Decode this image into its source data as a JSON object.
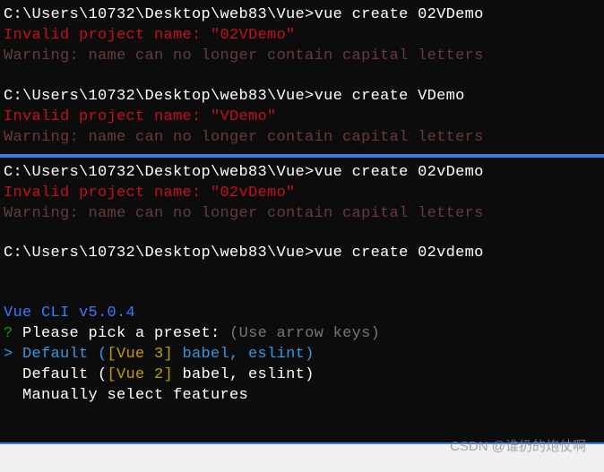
{
  "block1": {
    "prompt1_path": "C:\\Users\\10732\\Desktop\\web83\\Vue>",
    "prompt1_cmd": "vue create 02VDemo",
    "error1": "Invalid project name: \"02VDemo\"",
    "warning1": "Warning: name can no longer contain capital letters",
    "prompt2_path": "C:\\Users\\10732\\Desktop\\web83\\Vue>",
    "prompt2_cmd": "vue create VDemo",
    "error2": "Invalid project name: \"VDemo\"",
    "warning2": "Warning: name can no longer contain capital letters"
  },
  "block2": {
    "prompt3_path": "C:\\Users\\10732\\Desktop\\web83\\Vue>",
    "prompt3_cmd": "vue create 02vDemo",
    "error3": "Invalid project name: \"02vDemo\"",
    "warning3": "Warning: name can no longer contain capital letters",
    "prompt4_path": "C:\\Users\\10732\\Desktop\\web83\\Vue>",
    "prompt4_cmd": "vue create 02vdemo",
    "cli_version": "Vue CLI v5.0.4",
    "question_mark": "?",
    "preset_prompt": " Please pick a preset: ",
    "preset_hint": "(Use arrow keys)",
    "cursor": "> ",
    "option1_pre": "Default (",
    "option1_vue": "[Vue 3]",
    "option1_post": " babel, eslint)",
    "option2_pre": "  Default (",
    "option2_vue": "[Vue 2]",
    "option2_post": " babel, eslint)",
    "option3": "  Manually select features"
  },
  "watermark": "CSDN @谁扔的炮仗啊"
}
